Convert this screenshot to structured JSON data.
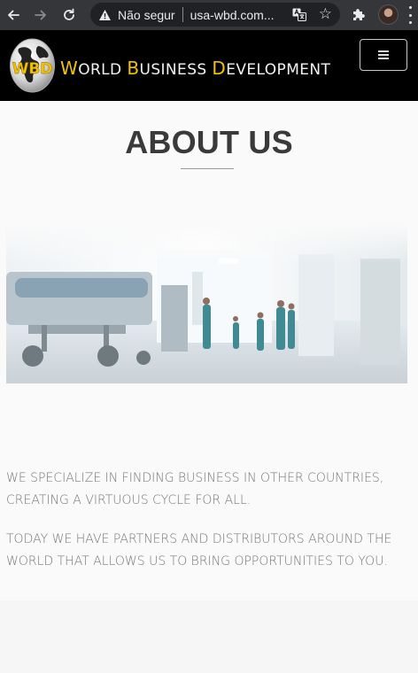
{
  "browser": {
    "security_status": "Não segur",
    "url": "usa-wbd.com..."
  },
  "site": {
    "logo_letters": "WBD",
    "brand_words": [
      {
        "initial": "W",
        "rest": "ORLD"
      },
      {
        "initial": "B",
        "rest": "USINESS"
      },
      {
        "initial": "D",
        "rest": "EVELOPMENT"
      }
    ]
  },
  "about": {
    "title": "ABOUT US",
    "paragraph_1": "We specialize in finding business in other countries, creating a virtuous cycle for all.",
    "paragraph_2": "Today we have partners and distributors around the world that allows us to bring opportunities to you."
  },
  "colors": {
    "header_bg": "#000000",
    "brand_gold": "#f2c200",
    "title": "#3a3a3a",
    "body_text": "#777777",
    "chrome_bg": "#35363a"
  }
}
